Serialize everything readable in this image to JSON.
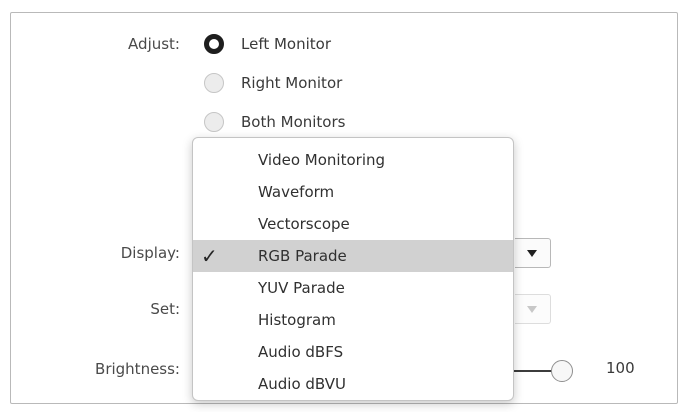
{
  "labels": {
    "adjust": "Adjust:",
    "display": "Display:",
    "set": "Set:",
    "brightness": "Brightness:"
  },
  "adjust_options": [
    {
      "label": "Left Monitor",
      "selected": true
    },
    {
      "label": "Right Monitor",
      "selected": false
    },
    {
      "label": "Both Monitors",
      "selected": false
    }
  ],
  "display_menu": {
    "items": [
      {
        "label": "Video Monitoring",
        "checked": false
      },
      {
        "label": "Waveform",
        "checked": false
      },
      {
        "label": "Vectorscope",
        "checked": false
      },
      {
        "label": "RGB Parade",
        "checked": true
      },
      {
        "label": "YUV Parade",
        "checked": false
      },
      {
        "label": "Histogram",
        "checked": false
      },
      {
        "label": "Audio dBFS",
        "checked": false
      },
      {
        "label": "Audio dBVU",
        "checked": false
      }
    ],
    "check_glyph": "✓"
  },
  "set_dropdown": {
    "enabled": false
  },
  "brightness": {
    "value": "100",
    "level": 1.0
  },
  "icons": {
    "dropdown_arrow": "chevron-down-icon",
    "check": "checkmark-icon"
  }
}
